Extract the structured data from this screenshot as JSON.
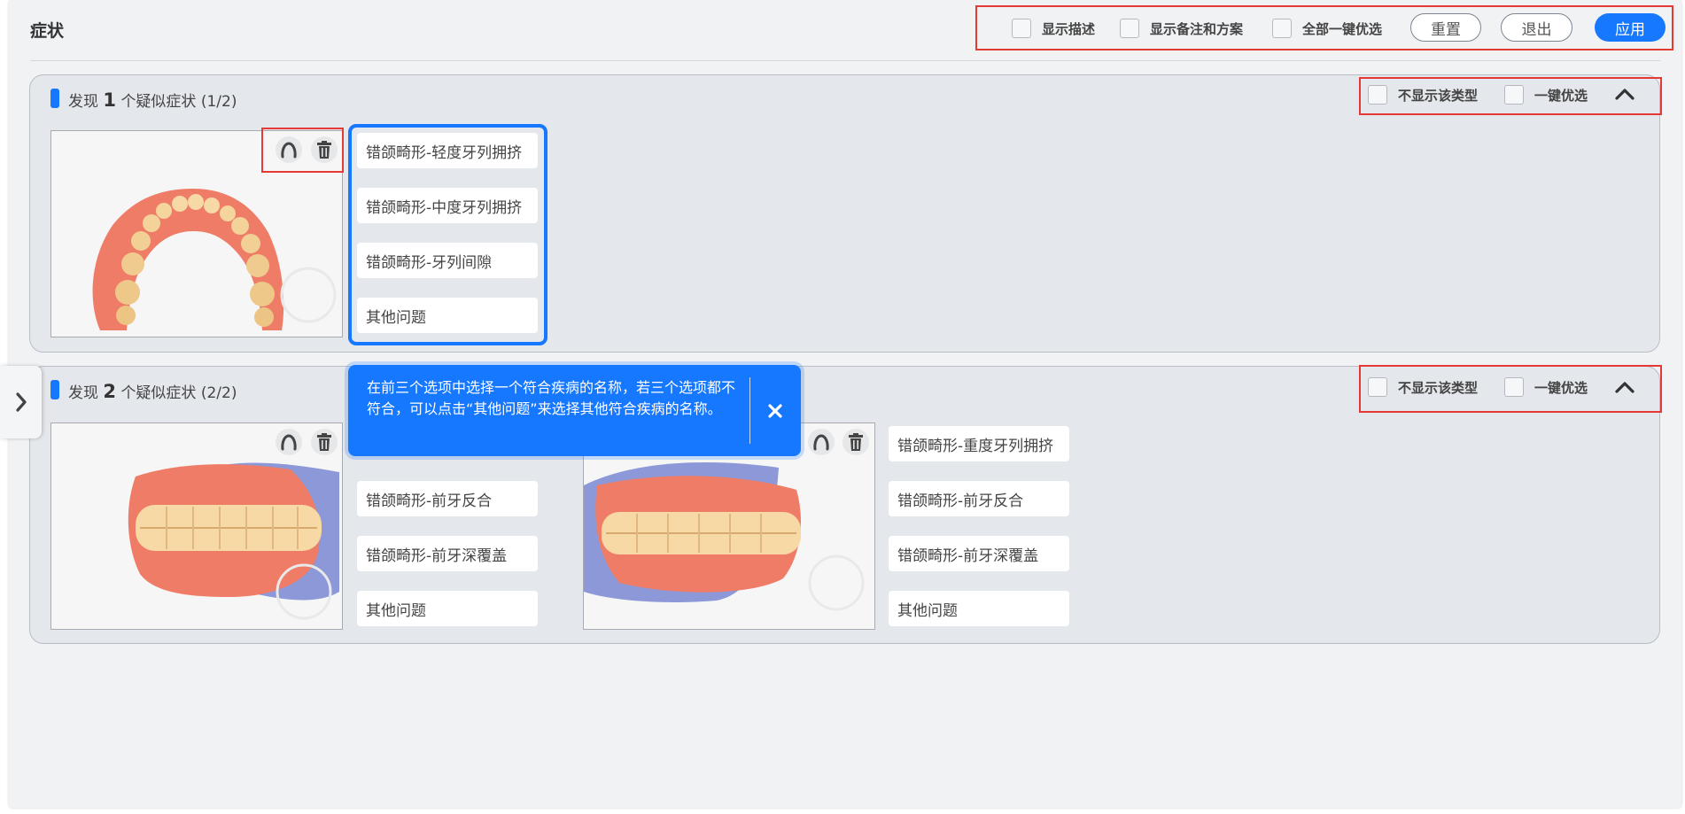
{
  "header": {
    "title": "症状",
    "show_description_label": "显示描述",
    "show_notes_label": "显示备注和方案",
    "select_all_label": "全部一键优选",
    "reset_label": "重置",
    "exit_label": "退出",
    "apply_label": "应用"
  },
  "sections": [
    {
      "prefix": "发现",
      "count": "1",
      "suffix": "个疑似症状 (1/2)",
      "hide_type_label": "不显示该类型",
      "quick_select_label": "一键优选",
      "cards": [
        {
          "options": [
            "错颌畸形-轻度牙列拥挤",
            "错颌畸形-中度牙列拥挤",
            "错颌畸形-牙列间隙",
            "其他问题"
          ]
        }
      ]
    },
    {
      "prefix": "发现",
      "count": "2",
      "suffix": "个疑似症状 (2/2)",
      "hide_type_label": "不显示该类型",
      "quick_select_label": "一键优选",
      "cards": [
        {
          "options": [
            "错颌畸形-前牙反合",
            "错颌畸形-前牙深覆盖",
            "其他问题"
          ]
        },
        {
          "options": [
            "错颌畸形-重度牙列拥挤",
            "错颌畸形-前牙反合",
            "错颌畸形-前牙深覆盖",
            "其他问题"
          ]
        }
      ]
    }
  ],
  "tooltip": {
    "text": "在前三个选项中选择一个符合疾病的名称，若三个选项都不符合，可以点击“其他问题”来选择其他符合疾病的名称。"
  },
  "icons": {
    "jaw": "jaw-icon",
    "delete": "trash-icon",
    "collapse": "chevron-up-icon",
    "close": "close-icon",
    "expand": "chevron-right-icon"
  },
  "colors": {
    "primary": "#1677ff",
    "highlight": "#e53935",
    "gum": "#ef7c66",
    "tooth": "#f6d9a4",
    "scan_base": "#8c98d8"
  }
}
